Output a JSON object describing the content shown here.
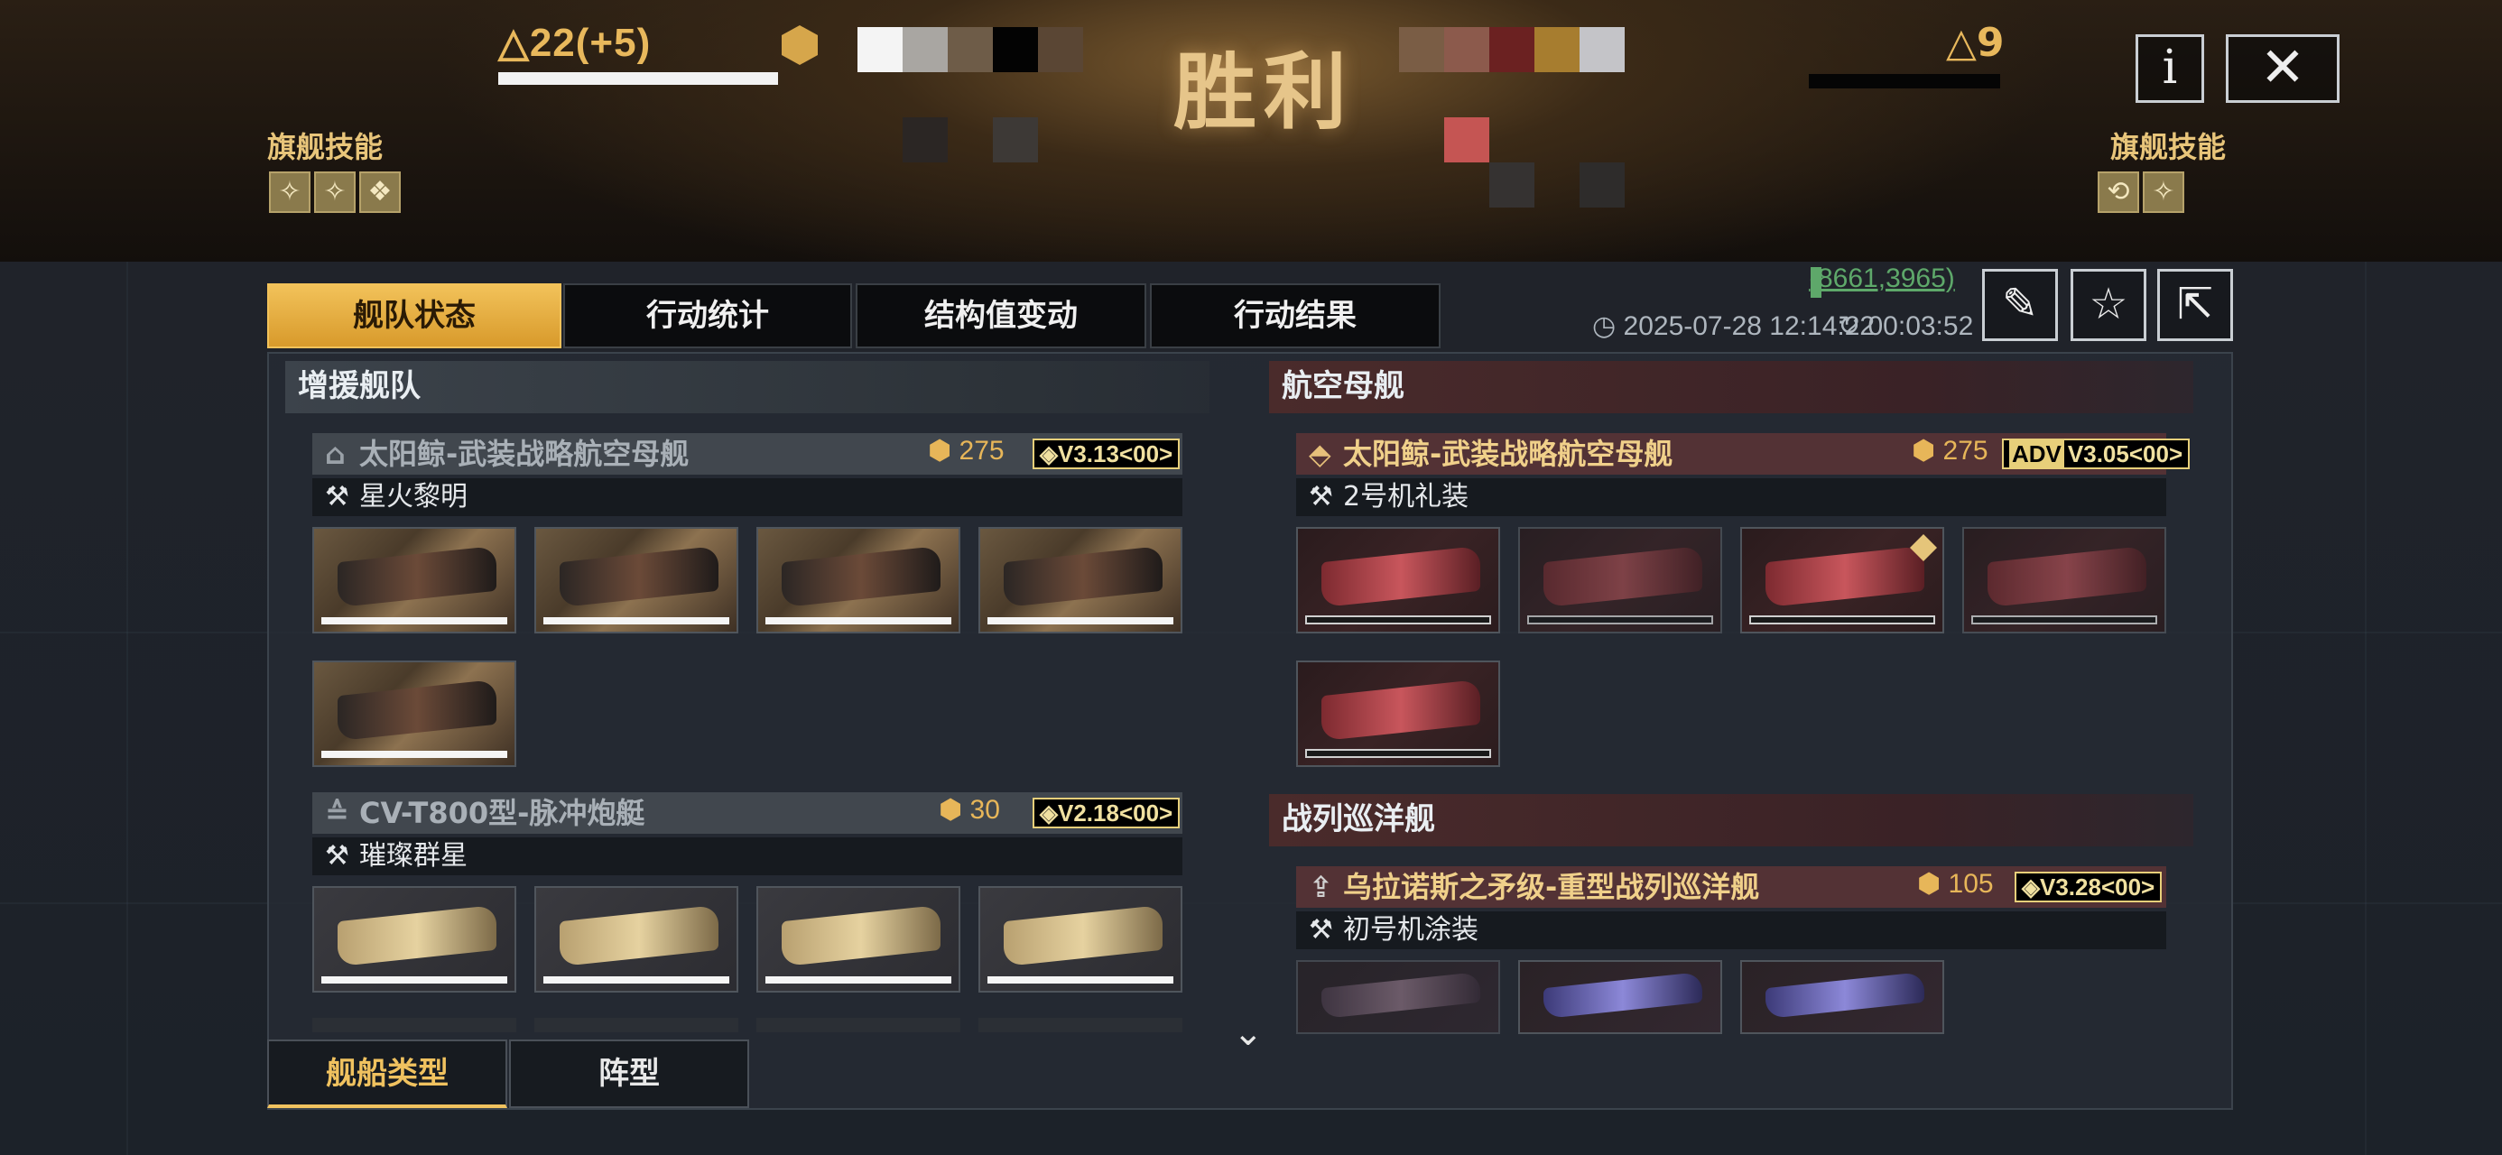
{
  "header": {
    "left_score": "△22(+5)",
    "right_score": "△9",
    "result": "胜利",
    "left_skill_label": "旗舰技能",
    "right_skill_label": "旗舰技能",
    "info_button": "i",
    "close_button": "✕"
  },
  "tabs": [
    {
      "label": "舰队状态",
      "active": true
    },
    {
      "label": "行动统计",
      "active": false
    },
    {
      "label": "结构值变动",
      "active": false
    },
    {
      "label": "行动结果",
      "active": false
    }
  ],
  "meta": {
    "coords": "(8661,3965)",
    "datetime": "2025-07-28 12:14:22",
    "duration": "00:03:52"
  },
  "left": {
    "section_title": "增援舰队",
    "ships": [
      {
        "name": "太阳鲸-武装战略航空母舰",
        "cost": "275",
        "version": "V3.13<00>",
        "paint": "星火黎明"
      },
      {
        "name": "CV-T800型-脉冲炮艇",
        "cost": "30",
        "version": "V2.18<00>",
        "paint": "璀璨群星"
      }
    ]
  },
  "right": {
    "sections": [
      {
        "title": "航空母舰"
      },
      {
        "title": "战列巡洋舰"
      }
    ],
    "ships": [
      {
        "name": "太阳鲸-武装战略航空母舰",
        "cost": "275",
        "version": "V3.05<00>",
        "paint": "2号机礼装"
      },
      {
        "name": "乌拉诺斯之矛级-重型战列巡洋舰",
        "cost": "105",
        "version": "V3.28<00>",
        "paint": "初号机涂装"
      }
    ]
  },
  "bottom_tabs": [
    {
      "label": "舰船类型",
      "active": true
    },
    {
      "label": "阵型",
      "active": false
    }
  ],
  "colors": {
    "accent": "#f0c25f",
    "enemy": "#5c3436"
  }
}
